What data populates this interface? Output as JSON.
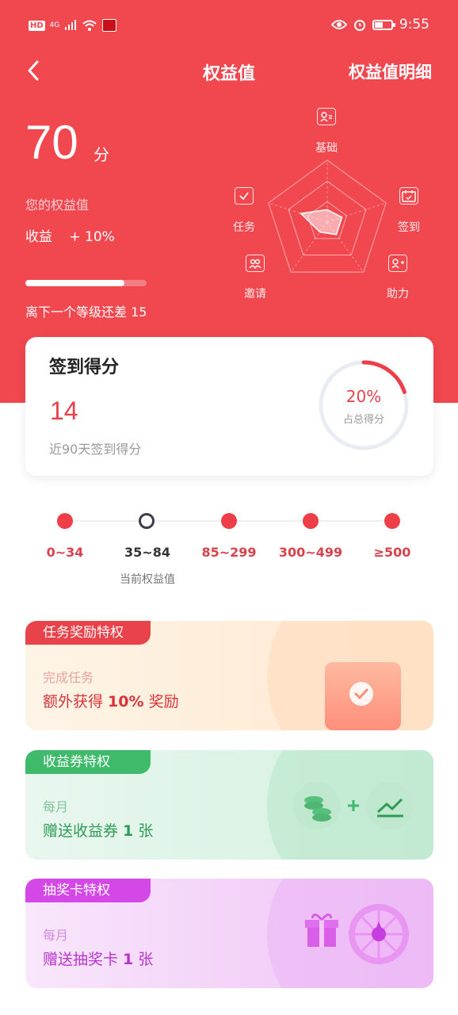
{
  "status_bar": {
    "hd": "HD",
    "network": "4G",
    "time": "9:55"
  },
  "nav": {
    "title": "权益值",
    "detail_link": "权益值明细"
  },
  "score": {
    "value": "70",
    "unit": "分",
    "label": "您的权益值",
    "income_label": "收益",
    "income_value": "+ 10%",
    "next_level_text": "离下一个等级还差  15",
    "level_progress": 0.82
  },
  "radar": {
    "labels": [
      "基础",
      "签到",
      "助力",
      "邀请",
      "任务"
    ],
    "values": [
      0.2,
      0.25,
      0.25,
      0.2,
      0.45
    ]
  },
  "sign_card": {
    "title": "签到得分",
    "value": "14",
    "subtitle": "近90天签到得分",
    "percent": "20%",
    "percent_value": 0.2,
    "percent_label": "占总得分"
  },
  "levels": {
    "tiers": [
      "0~34",
      "35~84",
      "85~299",
      "300~499",
      "≥500"
    ],
    "current_index": 1,
    "current_label": "当前权益值"
  },
  "privileges": [
    {
      "tag": "任务奖励特权",
      "line1": "完成任务",
      "line2_prefix": "额外获得 ",
      "line2_bold": "10%",
      "line2_suffix": " 奖励",
      "icon": "check-icon"
    },
    {
      "tag": "收益券特权",
      "line1": "每月",
      "line2_prefix": "赠送收益券 ",
      "line2_bold": "1",
      "line2_suffix": " 张",
      "icon": "coins-plus-chart-icon"
    },
    {
      "tag": "抽奖卡特权",
      "line1": "每月",
      "line2_prefix": "赠送抽奖卡 ",
      "line2_bold": "1",
      "line2_suffix": " 张",
      "icon": "gift-wheel-icon"
    }
  ],
  "colors": {
    "primary": "#f1474f",
    "task": "#e9424b",
    "coupon": "#3fba6b",
    "lottery": "#d448e7"
  }
}
